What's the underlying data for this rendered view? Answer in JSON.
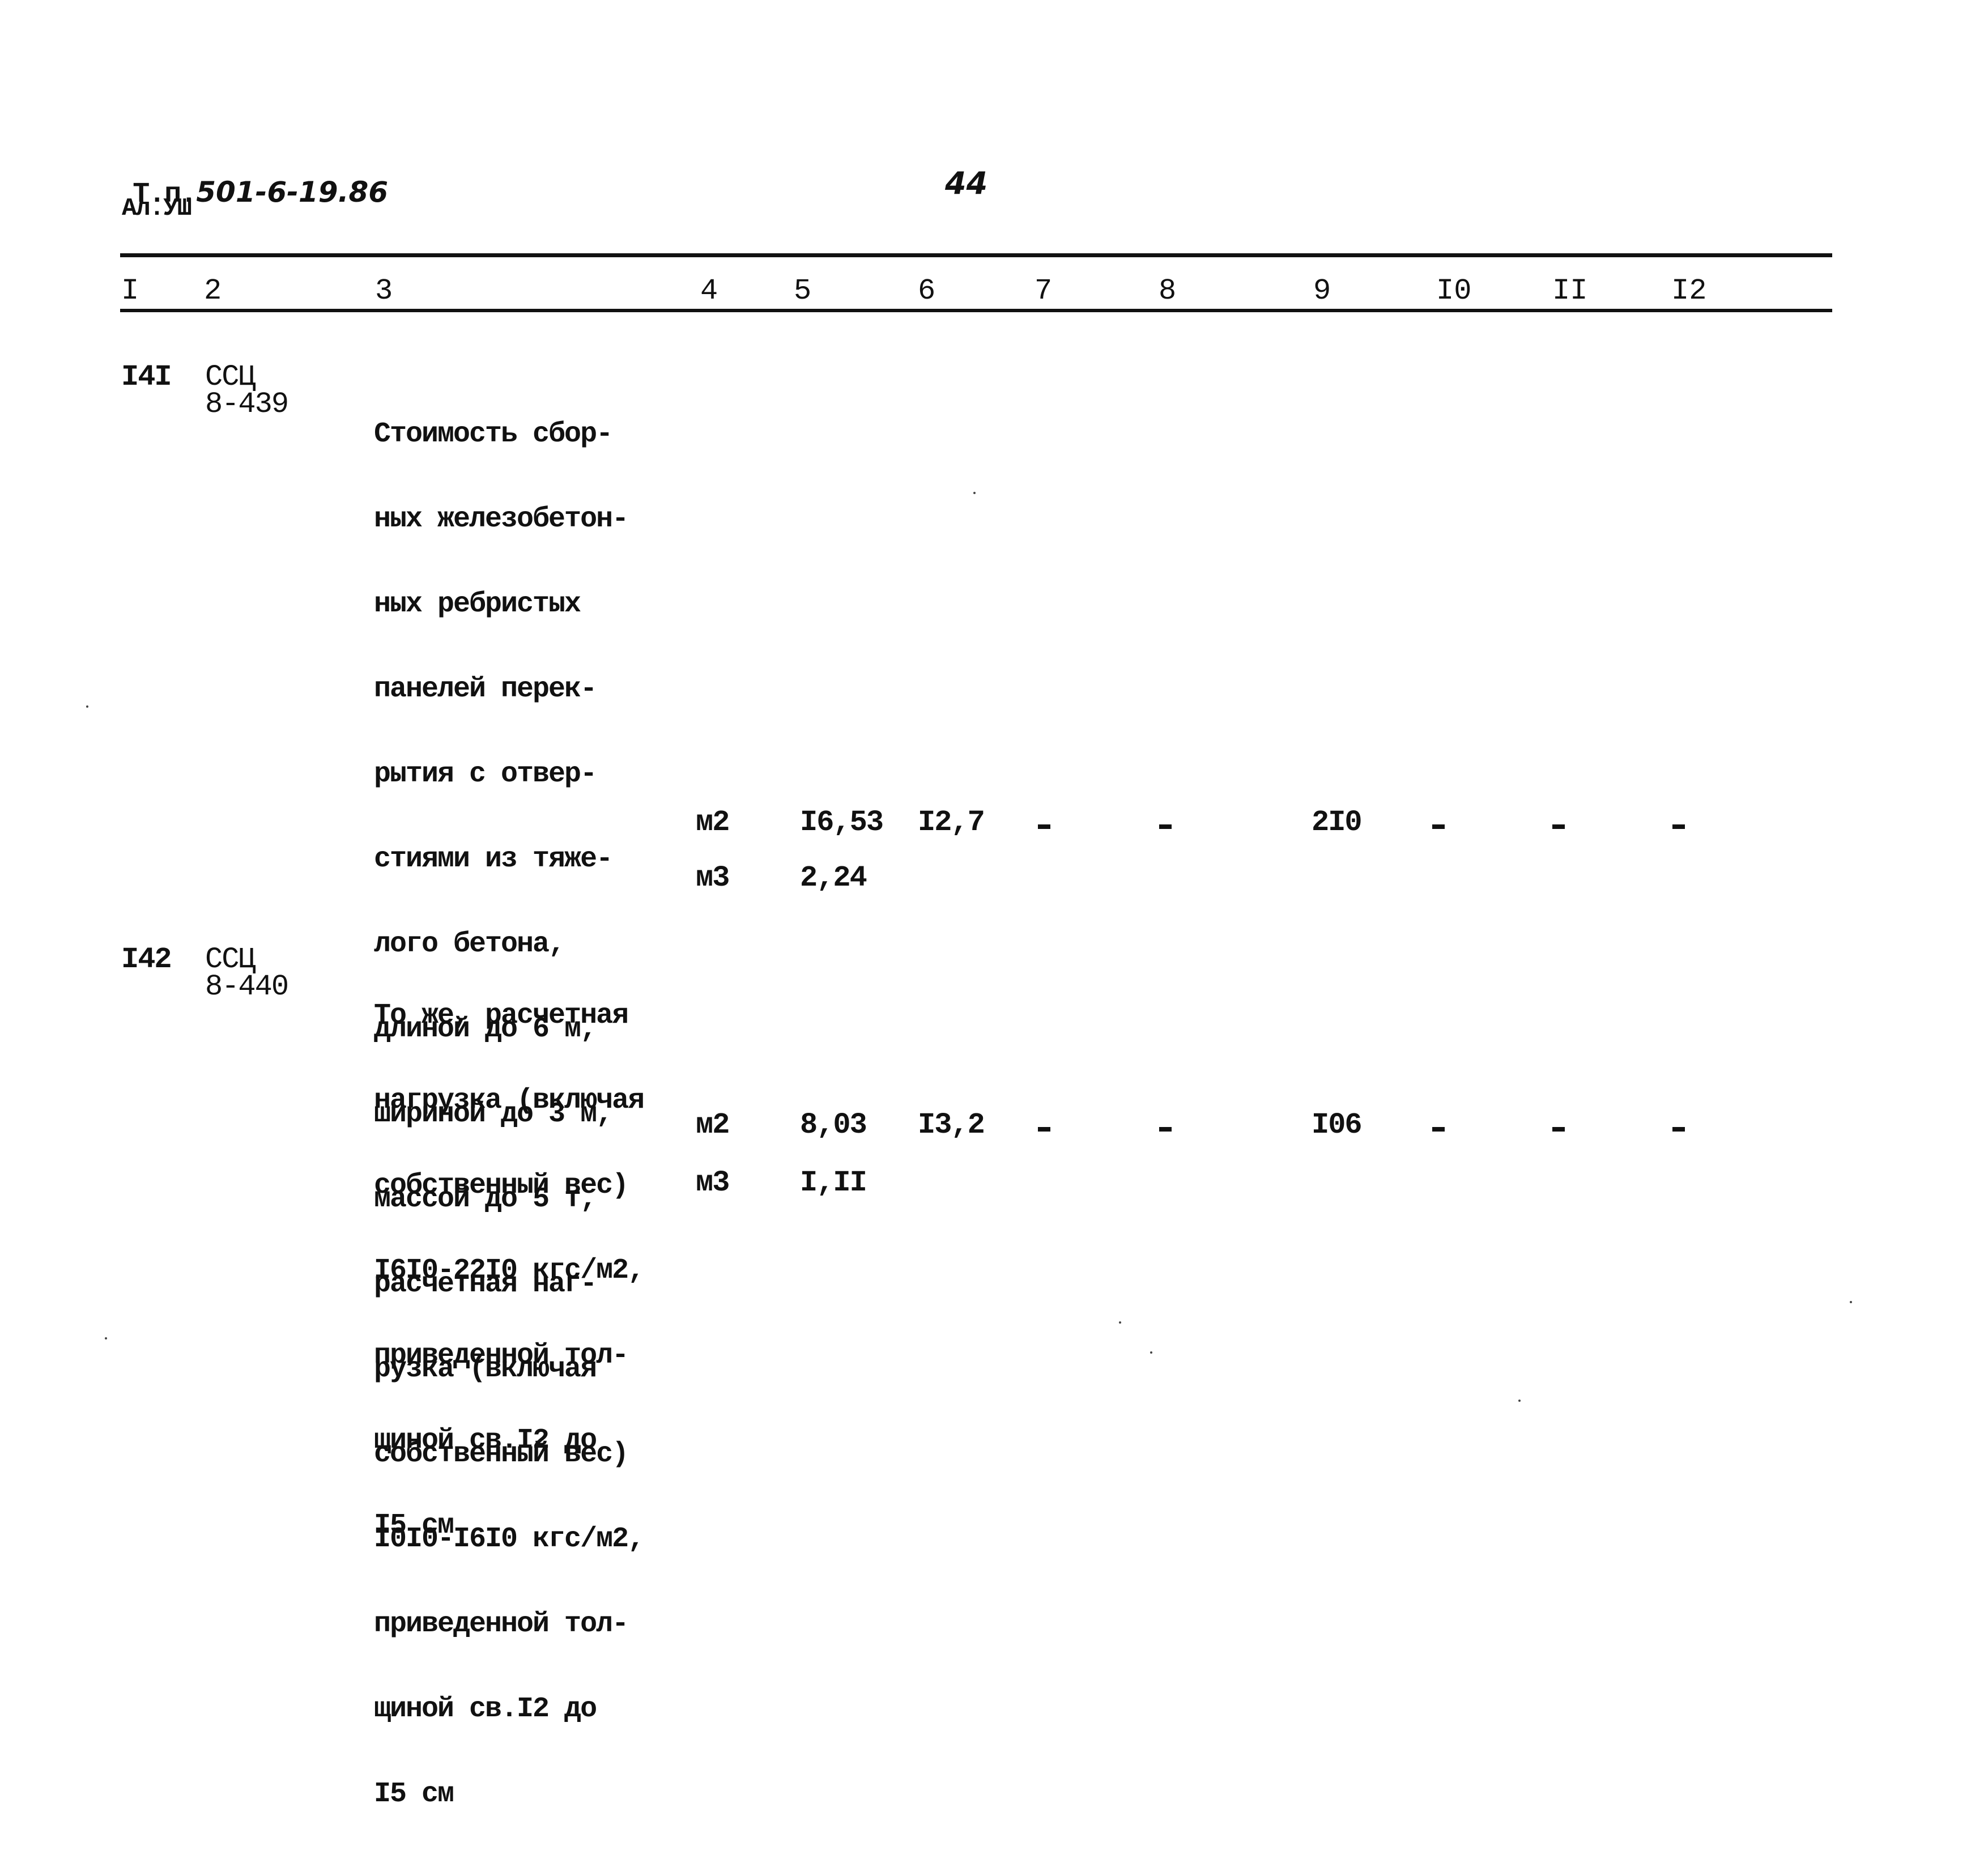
{
  "header": {
    "doc_prefix": "Т.п.",
    "doc_number": "501-6-19.86",
    "album": "Ал.УШ",
    "page_number": "44"
  },
  "table": {
    "column_numbers": [
      "I",
      "2",
      "3",
      "4",
      "5",
      "6",
      "7",
      "8",
      "9",
      "I0",
      "II",
      "I2"
    ],
    "rows": [
      {
        "num": "I4I",
        "code_line1": "ССЦ",
        "code_line2": "8-439",
        "description_lines": [
          "Стоимость сбор-",
          "ных железобетон-",
          "ных ребристых",
          "панелей перек-",
          "рытия с отвер-",
          "стиями из тяже-",
          "лого бетона,",
          "длиной до 6 м,",
          "шириной до 3 м,",
          "массой до 5 т,",
          "расчетная наг-",
          "рузка (включая",
          "собственный вес)",
          "I0I0-I6I0 кгс/м2,",
          "приведенной тол-",
          "щиной св.I2 до",
          "I5 см"
        ],
        "lines": [
          {
            "unit": "м2",
            "col5": "I6,53",
            "col6": "I2,7",
            "col7": "-",
            "col8": "-",
            "col9": "2I0",
            "col10": "-",
            "col11": "-",
            "col12": "-"
          },
          {
            "unit": "м3",
            "col5": "2,24"
          }
        ]
      },
      {
        "num": "I42",
        "code_line1": "ССЦ",
        "code_line2": "8-440",
        "description_lines": [
          "То же, расчетная",
          "нагрузка (включая",
          "собственный вес)",
          "I6I0-22I0 кгс/м2,",
          "приведенной тол-",
          "щиной св.I2 до",
          "I5 см"
        ],
        "lines": [
          {
            "unit": "м2",
            "col5": "8,03",
            "col6": "I3,2",
            "col7": "-",
            "col8": "-",
            "col9": "I06",
            "col10": "-",
            "col11": "-",
            "col12": "-"
          },
          {
            "unit": "м3",
            "col5": "I,II"
          }
        ]
      }
    ]
  }
}
